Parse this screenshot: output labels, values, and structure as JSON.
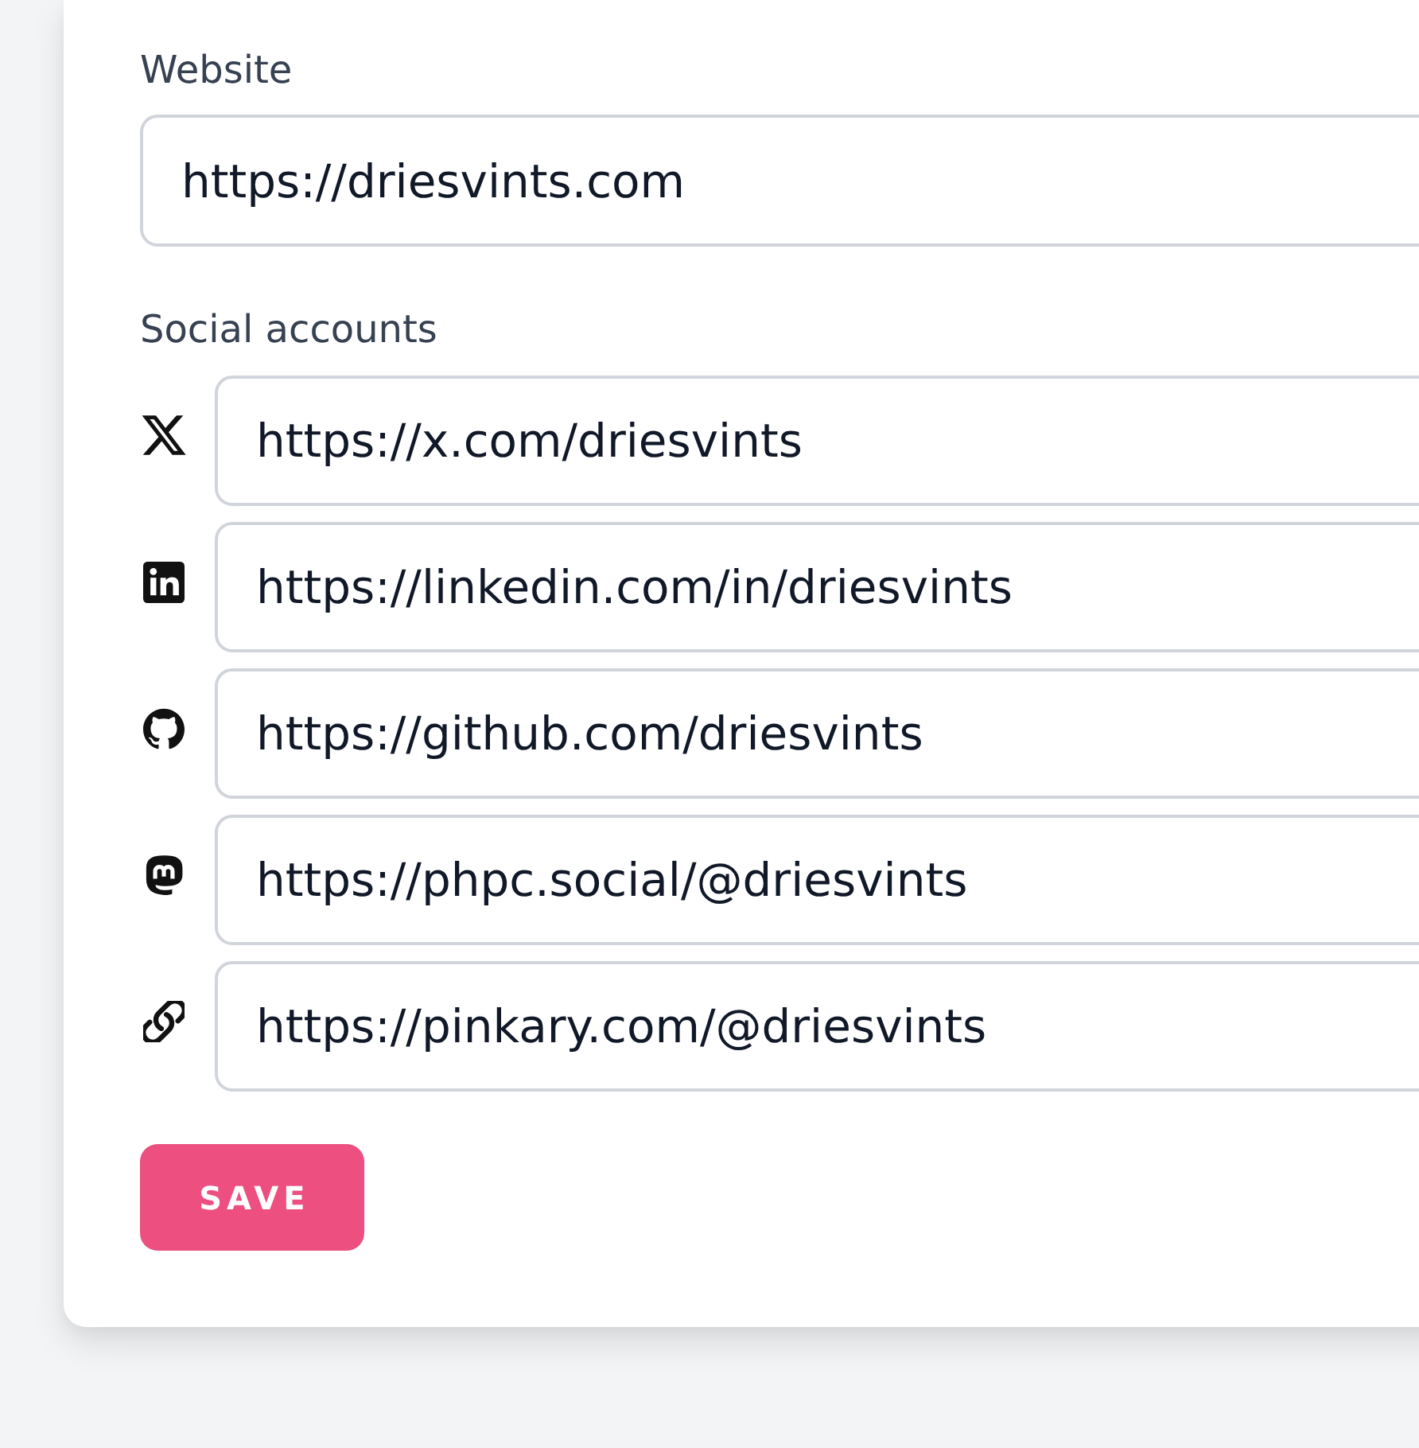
{
  "website": {
    "label": "Website",
    "value": "https://driesvints.com"
  },
  "social_accounts": {
    "label": "Social accounts",
    "accounts": [
      {
        "kind": "x",
        "value": "https://x.com/driesvints"
      },
      {
        "kind": "linkedin",
        "value": "https://linkedin.com/in/driesvints"
      },
      {
        "kind": "github",
        "value": "https://github.com/driesvints"
      },
      {
        "kind": "mastodon",
        "value": "https://phpc.social/@driesvints"
      },
      {
        "kind": "link",
        "value": "https://pinkary.com/@driesvints"
      }
    ]
  },
  "save_button": {
    "label": "SAVE"
  }
}
